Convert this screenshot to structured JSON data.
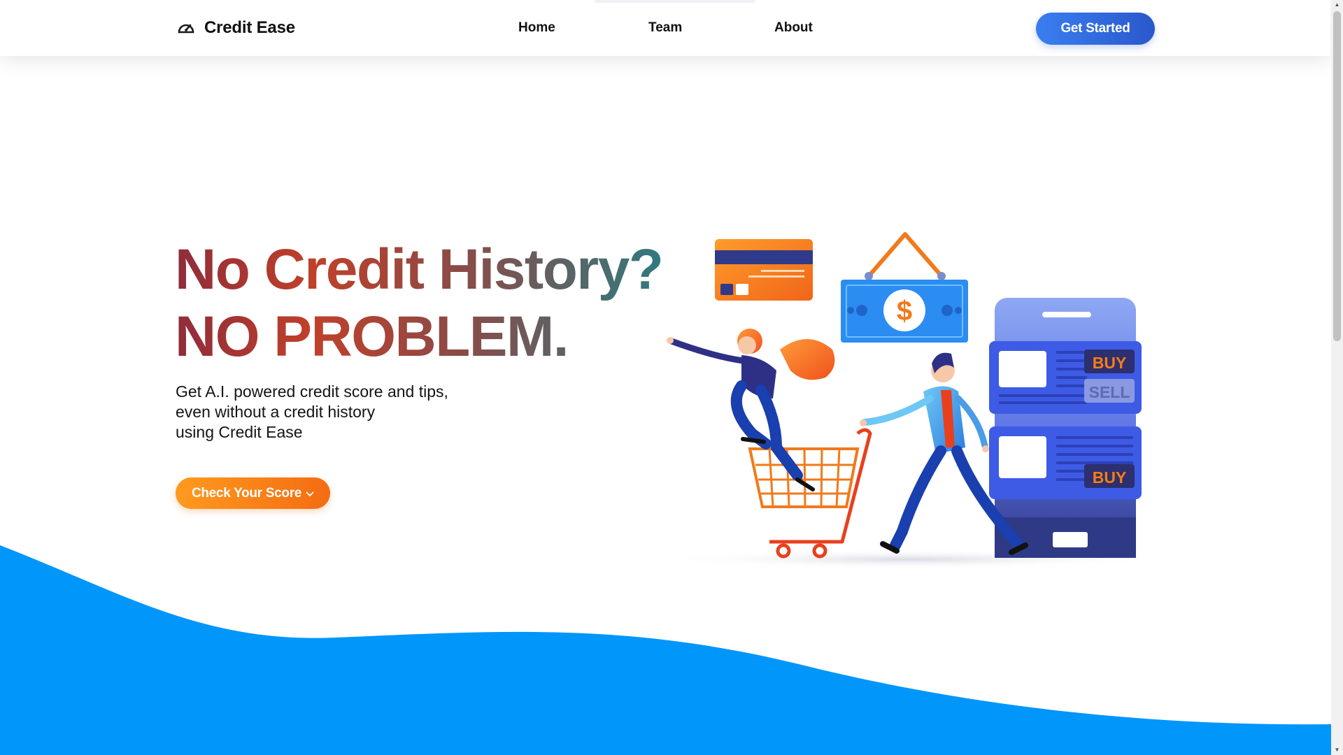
{
  "header": {
    "brand_name": "Credit Ease",
    "brand_icon": "speedometer-icon",
    "nav": {
      "home": "Home",
      "team": "Team",
      "about": "About"
    },
    "cta_label": "Get Started"
  },
  "hero": {
    "title_line1": "No Credit History?",
    "title_line2": "NO PROBLEM.",
    "description": [
      "Get A.I. powered credit score and tips,",
      "even without a credit history",
      "using Credit Ease"
    ],
    "button_label": "Check Your Score",
    "button_icon": "chevron-down-icon"
  },
  "illustration": {
    "buy_label_1": "BUY",
    "sell_label": "SELL",
    "buy_label_2": "BUY",
    "currency_symbol": "$"
  },
  "colors": {
    "primary_blue": "#2f6fe0",
    "accent_orange": "#f57d14",
    "wave_blue": "#0096fa",
    "title_gradient": [
      "#8f2c3a",
      "#c0402a",
      "#8c4a46",
      "#2f7a80"
    ]
  }
}
